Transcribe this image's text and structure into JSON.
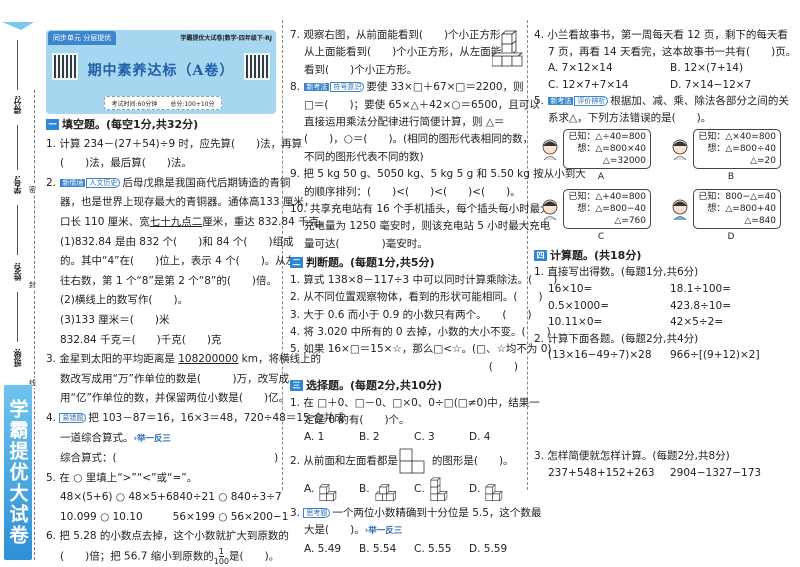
{
  "margin": {
    "labels": [
      "得分:",
      "学号:",
      "姓名:",
      "班级:"
    ],
    "seal": [
      "密",
      "封",
      "线"
    ],
    "brand": "学霸提优大试卷"
  },
  "header": {
    "series_tag": "同步单元 分层提优",
    "book": "学霸提优大试卷|数学·四年级下·RJ",
    "title": "期中素养达标（A卷）",
    "time": "考试时间:60分钟",
    "score": "总分:100+10分"
  },
  "col1": [
    {
      "h": "一",
      "t": [
        "填空题。(每空1分,共32分)"
      ]
    },
    {
      "t": [
        "1. 计算 234－(27＋54)÷9 时，应先算(　　)法，再算"
      ]
    },
    {
      "i": 1,
      "t": [
        "(　　)法，最后算(　　)法。"
      ]
    },
    {
      "t": [
        "2. ",
        {
          "b": "新情境"
        },
        {
          "o": "人文历史"
        },
        "后母戊鼎是我国商代后期铸造的青铜"
      ]
    },
    {
      "i": 1,
      "t": [
        "器，也是世界上现存最大的青铜器。通体高133 厘米，"
      ]
    },
    {
      "i": 1,
      "t": [
        "口长 110 厘米、宽",
        {
          "u": "七十九点二"
        },
        "厘米，重达 832.84 千克。"
      ]
    },
    {
      "i": 1,
      "t": [
        "(1)832.84 是由 832 个(　　)和 84 个(　　)组成"
      ]
    },
    {
      "i": 1,
      "t": [
        "的。其中“4”在(　　)位上，表示 4 个(　　)。从左"
      ]
    },
    {
      "i": 1,
      "t": [
        "往右数，第 1 个“8”是第 2 个“8”的(　　)倍。"
      ]
    },
    {
      "i": 1,
      "t": [
        "(2)横线上的数写作(　　)。"
      ]
    },
    {
      "i": 1,
      "t": [
        "(3)133 厘米＝(　　)米"
      ]
    },
    {
      "i": 1,
      "t": [
        "832.84 千克＝(　　)千克(　　)克"
      ]
    },
    {
      "t": [
        "3. 金星到太阳的平均距离是 ",
        {
          "u": "108200000"
        },
        " km，将横线上的"
      ]
    },
    {
      "i": 1,
      "t": [
        "数改写成用“万”作单位的数是(　　　)万，改写成"
      ]
    },
    {
      "i": 1,
      "t": [
        "用“亿”作单位的数，并保留两位小数是(　　)亿。"
      ]
    },
    {
      "t": [
        "4. ",
        {
          "o": "易错题"
        },
        "把 103－87＝16，16×3＝48，720÷48＝15 合并成"
      ]
    },
    {
      "i": 1,
      "t": [
        "一道综合算式。",
        {
          "l": "›举一反三"
        }
      ]
    },
    {
      "i": 1,
      "t": [
        "综合算式：(　　　　　　　　　　　　　　　)"
      ]
    },
    {
      "t": [
        "5. 在 ○ 里填上“>”“<”或“=”。"
      ]
    },
    {
      "g": [
        "48×(5+6) ○ 48×5+6",
        "840÷21 ○ 840÷3÷7",
        "10.099 ○ 10.10",
        "56×199 ○ 56×200−1"
      ]
    },
    {
      "t": [
        "6. 把 5.28 的小数点去掉，这个小数就扩大到原数的"
      ]
    },
    {
      "i": 1,
      "t": [
        "(　　)倍；把 56.7 缩小到原数的",
        {
          "f": [
            "1",
            "100"
          ]
        },
        "是(　　)。"
      ]
    }
  ],
  "col2": [
    {
      "t": [
        "7. 观察右图，从前面能看到(　　)个小正方形，"
      ]
    },
    {
      "i": 1,
      "t": [
        "从上面能看到(　　)个小正方形，从左面能"
      ]
    },
    {
      "i": 1,
      "t": [
        "看到(　　)个小正方形。"
      ]
    },
    {
      "t": [
        "8. ",
        {
          "b": "新考法"
        },
        {
          "o": "符号意识"
        },
        "要使 33×□＋67×□＝2200，则"
      ]
    },
    {
      "i": 1,
      "t": [
        "□＝(　　)；要使 65×△＋42×○＝6500，且可以"
      ]
    },
    {
      "i": 1,
      "t": [
        "直接运用乘法分配律进行简便计算，则 △＝"
      ]
    },
    {
      "i": 1,
      "t": [
        "(　　)，○＝(　　)。(相同的图形代表相同的数，"
      ]
    },
    {
      "i": 1,
      "t": [
        "不同的图形代表不同的数)"
      ]
    },
    {
      "t": [
        "9. 把 5 kg 50 g、5050 kg、5 kg 5 g 和 5.50 kg 按从小到大"
      ]
    },
    {
      "i": 1,
      "t": [
        "的顺序排列：(　　)<(　　)<(　　)<(　　)。"
      ]
    },
    {
      "t": [
        "10. 共享充电站有 16 个手机插头，每个插头每小时最大"
      ]
    },
    {
      "i": 1,
      "t": [
        "充电量为 1250 毫安时，则该充电站 5 小时最大充电"
      ]
    },
    {
      "i": 1,
      "t": [
        "量可达(　　　　)毫安时。"
      ]
    },
    {
      "h": "二",
      "t": [
        "判断题。(每题1分,共5分)"
      ]
    },
    {
      "t": [
        "1. 算式 138×8－117÷3 中可以同时计算乘除法。(　　)"
      ]
    },
    {
      "t": [
        "2. 从不同位置观察物体，看到的形状可能相同。(　　)"
      ]
    },
    {
      "t": [
        "3. 大于 0.6 而小于 0.9 的小数只有两个。　　(　　)"
      ]
    },
    {
      "t": [
        "4. 将 3.020 中所有的 0 去掉，小数的大小不变。(　　)"
      ]
    },
    {
      "t": [
        "5. 如果 16×□＝15×☆，那么□<☆。(□、☆均不为 0)"
      ]
    },
    {
      "r": 1,
      "t": [
        "(　　)"
      ]
    },
    {
      "h": "三",
      "t": [
        "选择题。(每题2分,共10分)"
      ]
    },
    {
      "t": [
        "1. 在 □＋0、□－0、□×0、0÷□(□≠0)中，结果一"
      ]
    },
    {
      "i": 1,
      "t": [
        "定是 0 的有(　　)个。"
      ]
    },
    {
      "o": [
        "A. 1",
        "B. 2",
        "C. 3",
        "D. 4"
      ]
    },
    {
      "t": [
        "2. 从前面和左面看都是",
        {
          "fig": "view"
        },
        "的图形是(　　)。"
      ]
    },
    {
      "o": [
        "A.",
        "B.",
        "C.",
        "D."
      ],
      "figs": 1
    },
    {
      "t": [
        "3. ",
        {
          "o": "思考题"
        },
        "一个两位小数精确到十分位是 5.5，这个数最"
      ]
    },
    {
      "i": 1,
      "t": [
        "大是(　　)。",
        {
          "l": "›举一反三"
        }
      ]
    },
    {
      "o": [
        "A. 5.49",
        "B. 5.54",
        "C. 5.55",
        "D. 5.59"
      ]
    }
  ],
  "col3": [
    {
      "t": [
        "4. 小兰看故事书，第一周每天看 12 页，剩下的每天看"
      ]
    },
    {
      "i": 1,
      "t": [
        "7 页，再看 14 天看完，这本故事书一共有(　　)页。"
      ]
    },
    {
      "o": [
        "A. 7×12×14",
        "B. 12×(7+14)"
      ]
    },
    {
      "o": [
        "C. 12×7+7×14",
        "D. 7×14−12×7"
      ]
    },
    {
      "t": [
        "5. ",
        {
          "b": "新考法"
        },
        {
          "o": "评价辨析"
        },
        "根据加、减、乘、除法各部分之间的关"
      ]
    },
    {
      "i": 1,
      "t": [
        "系求△，下列方法错误的是(　　)。"
      ]
    },
    {
      "bub": [
        {
          "label": "A",
          "lines": [
            "已知：△÷40=800",
            "想：△=800×40",
            "△=32000"
          ]
        },
        {
          "label": "B",
          "lines": [
            "已知：△×40=800",
            "想：△=800÷40",
            "△=20"
          ]
        },
        {
          "label": "C",
          "lines": [
            "已知：△+40=800",
            "想：△=800−40",
            "△=760"
          ]
        },
        {
          "label": "D",
          "lines": [
            "已知：800−△=40",
            "想：△=800+40",
            "△=840"
          ]
        }
      ]
    },
    {
      "h": "四",
      "t": [
        "计算题。(共18分)"
      ]
    },
    {
      "t": [
        "1. 直接写出得数。(每题1分,共6分)"
      ]
    },
    {
      "g": [
        "16×10=",
        "18.1÷100=",
        "0.5×1000=",
        "423.8÷10=",
        "10.11×0=",
        "42×5÷2="
      ]
    },
    {
      "t": [
        "2. 计算下面各题。(每题2分,共4分)"
      ]
    },
    {
      "g": [
        "(13×16−49÷7)×28",
        "966÷[(9+12)×2]"
      ]
    },
    {
      "sp": 1
    },
    {
      "t": [
        "3. 怎样简便就怎样计算。(每题2分,共8分)"
      ]
    },
    {
      "g": [
        "237+548+152+263",
        "2904−1327−173"
      ]
    }
  ],
  "colors": {
    "accent": "#2f86d2",
    "header_bg": "#a6d6f0",
    "title": "#1f5fa8"
  }
}
